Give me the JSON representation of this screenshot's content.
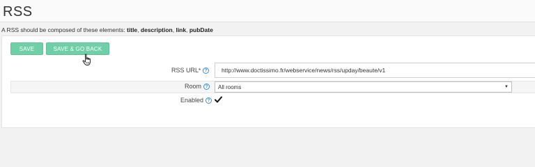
{
  "page": {
    "title": "RSS",
    "description_prefix": "A RSS should be composed of these elements:",
    "elements": [
      "title",
      "description",
      "link",
      "pubDate"
    ]
  },
  "toolbar": {
    "save_label": "SAVE",
    "save_back_label": "SAVE & GO BACK"
  },
  "form": {
    "rss_url": {
      "label": "RSS URL",
      "required_mark": "*",
      "value": "http://www.doctissimo.fr/webservice/news/rss/upday/beaute/v1"
    },
    "room": {
      "label": "Room",
      "selected": "All rooms"
    },
    "enabled": {
      "label": "Enabled",
      "checked": true
    }
  },
  "icons": {
    "help": "help-icon",
    "dropdown": "chevron-down-icon",
    "check": "checkmark-icon",
    "cursor": "hand-pointer-icon"
  },
  "colors": {
    "button": "#6fcfa6",
    "help_icon": "#3b8fd6"
  }
}
